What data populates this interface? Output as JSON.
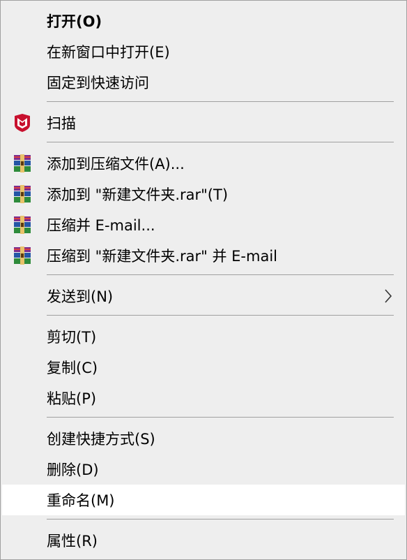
{
  "menu": {
    "items": [
      {
        "label": "打开(O)"
      },
      {
        "label": "在新窗口中打开(E)"
      },
      {
        "label": "固定到快速访问"
      },
      {
        "label": "扫描"
      },
      {
        "label": "添加到压缩文件(A)..."
      },
      {
        "label": "添加到 \"新建文件夹.rar\"(T)"
      },
      {
        "label": "压缩并 E-mail..."
      },
      {
        "label": "压缩到 \"新建文件夹.rar\" 并 E-mail"
      },
      {
        "label": "发送到(N)"
      },
      {
        "label": "剪切(T)"
      },
      {
        "label": "复制(C)"
      },
      {
        "label": "粘贴(P)"
      },
      {
        "label": "创建快捷方式(S)"
      },
      {
        "label": "删除(D)"
      },
      {
        "label": "重命名(M)"
      },
      {
        "label": "属性(R)"
      }
    ]
  },
  "colors": {
    "menu_bg": "#eeeeee",
    "hover_bg": "#ffffff",
    "separator": "#a0a0a0",
    "mcafee_red": "#c8102e"
  },
  "icons": {
    "scan": "mcafee-shield-icon",
    "winrar": "winrar-books-icon",
    "submenu": "chevron-right-icon"
  }
}
